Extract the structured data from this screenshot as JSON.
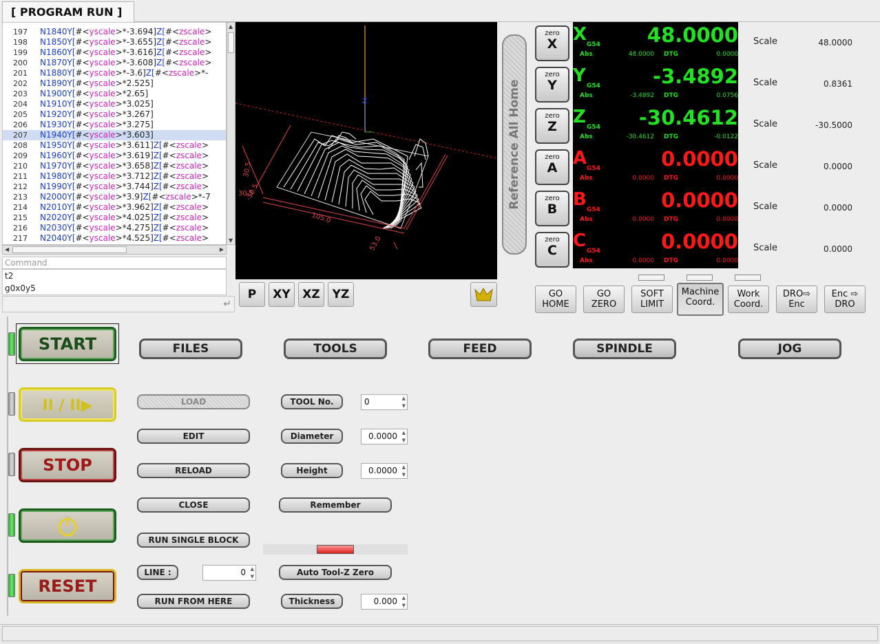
{
  "tab": {
    "title": "[ PROGRAM RUN ]"
  },
  "gcode_lines": [
    {
      "num": "197",
      "n": "N1840",
      "rest": [
        [
          "c-k",
          "Y["
        ],
        [
          "c-v",
          "#<"
        ],
        [
          "c-p",
          "yscale"
        ],
        [
          "c-v",
          ">*-3.694]"
        ],
        [
          "c-k",
          "Z["
        ],
        [
          "c-v",
          "#<"
        ],
        [
          "c-p",
          "zscale"
        ],
        [
          "c-v",
          ">"
        ]
      ]
    },
    {
      "num": "198",
      "n": "N1850",
      "rest": [
        [
          "c-k",
          "Y["
        ],
        [
          "c-v",
          "#<"
        ],
        [
          "c-p",
          "yscale"
        ],
        [
          "c-v",
          ">*-3.655]"
        ],
        [
          "c-k",
          "Z["
        ],
        [
          "c-v",
          "#<"
        ],
        [
          "c-p",
          "zscale"
        ],
        [
          "c-v",
          ">"
        ]
      ]
    },
    {
      "num": "199",
      "n": "N1860",
      "rest": [
        [
          "c-k",
          "Y["
        ],
        [
          "c-v",
          "#<"
        ],
        [
          "c-p",
          "yscale"
        ],
        [
          "c-v",
          ">*-3.616]"
        ],
        [
          "c-k",
          "Z["
        ],
        [
          "c-v",
          "#<"
        ],
        [
          "c-p",
          "zscale"
        ],
        [
          "c-v",
          ">"
        ]
      ]
    },
    {
      "num": "200",
      "n": "N1870",
      "rest": [
        [
          "c-k",
          "Y["
        ],
        [
          "c-v",
          "#<"
        ],
        [
          "c-p",
          "yscale"
        ],
        [
          "c-v",
          ">*-3.608]"
        ],
        [
          "c-k",
          "Z["
        ],
        [
          "c-v",
          "#<"
        ],
        [
          "c-p",
          "zscale"
        ],
        [
          "c-v",
          ">"
        ]
      ]
    },
    {
      "num": "201",
      "n": "N1880",
      "rest": [
        [
          "c-k",
          "Y["
        ],
        [
          "c-v",
          "#<"
        ],
        [
          "c-p",
          "yscale"
        ],
        [
          "c-v",
          ">*-3.6]"
        ],
        [
          "c-k",
          "Z["
        ],
        [
          "c-v",
          "#<"
        ],
        [
          "c-p",
          "zscale"
        ],
        [
          "c-v",
          ">*-"
        ]
      ]
    },
    {
      "num": "202",
      "n": "N1890",
      "rest": [
        [
          "c-k",
          "Y["
        ],
        [
          "c-v",
          "#<"
        ],
        [
          "c-p",
          "yscale"
        ],
        [
          "c-v",
          ">*2.525]"
        ]
      ]
    },
    {
      "num": "203",
      "n": "N1900",
      "rest": [
        [
          "c-k",
          "Y["
        ],
        [
          "c-v",
          "#<"
        ],
        [
          "c-p",
          "yscale"
        ],
        [
          "c-v",
          ">*2.65]"
        ]
      ]
    },
    {
      "num": "204",
      "n": "N1910",
      "rest": [
        [
          "c-k",
          "Y["
        ],
        [
          "c-v",
          "#<"
        ],
        [
          "c-p",
          "yscale"
        ],
        [
          "c-v",
          ">*3.025]"
        ]
      ]
    },
    {
      "num": "205",
      "n": "N1920",
      "rest": [
        [
          "c-k",
          "Y["
        ],
        [
          "c-v",
          "#<"
        ],
        [
          "c-p",
          "yscale"
        ],
        [
          "c-v",
          ">*3.267]"
        ]
      ]
    },
    {
      "num": "206",
      "n": "N1930",
      "rest": [
        [
          "c-k",
          "Y["
        ],
        [
          "c-v",
          "#<"
        ],
        [
          "c-p",
          "yscale"
        ],
        [
          "c-v",
          ">*3.275]"
        ]
      ]
    },
    {
      "num": "207",
      "n": "N1940",
      "rest": [
        [
          "c-k",
          "Y["
        ],
        [
          "c-v",
          "#<"
        ],
        [
          "c-p",
          "yscale"
        ],
        [
          "c-v",
          ">*3.603]"
        ]
      ],
      "selected": true
    },
    {
      "num": "208",
      "n": "N1950",
      "rest": [
        [
          "c-k",
          "Y["
        ],
        [
          "c-v",
          "#<"
        ],
        [
          "c-p",
          "yscale"
        ],
        [
          "c-v",
          ">*3.611]"
        ],
        [
          "c-k",
          "Z["
        ],
        [
          "c-v",
          "#<"
        ],
        [
          "c-p",
          "zscale"
        ],
        [
          "c-v",
          ">"
        ]
      ]
    },
    {
      "num": "209",
      "n": "N1960",
      "rest": [
        [
          "c-k",
          "Y["
        ],
        [
          "c-v",
          "#<"
        ],
        [
          "c-p",
          "yscale"
        ],
        [
          "c-v",
          ">*3.619]"
        ],
        [
          "c-k",
          "Z["
        ],
        [
          "c-v",
          "#<"
        ],
        [
          "c-p",
          "zscale"
        ],
        [
          "c-v",
          ">"
        ]
      ]
    },
    {
      "num": "210",
      "n": "N1970",
      "rest": [
        [
          "c-k",
          "Y["
        ],
        [
          "c-v",
          "#<"
        ],
        [
          "c-p",
          "yscale"
        ],
        [
          "c-v",
          ">*3.658]"
        ],
        [
          "c-k",
          "Z["
        ],
        [
          "c-v",
          "#<"
        ],
        [
          "c-p",
          "zscale"
        ],
        [
          "c-v",
          ">"
        ]
      ]
    },
    {
      "num": "211",
      "n": "N1980",
      "rest": [
        [
          "c-k",
          "Y["
        ],
        [
          "c-v",
          "#<"
        ],
        [
          "c-p",
          "yscale"
        ],
        [
          "c-v",
          ">*3.712]"
        ],
        [
          "c-k",
          "Z["
        ],
        [
          "c-v",
          "#<"
        ],
        [
          "c-p",
          "zscale"
        ],
        [
          "c-v",
          ">"
        ]
      ]
    },
    {
      "num": "212",
      "n": "N1990",
      "rest": [
        [
          "c-k",
          "Y["
        ],
        [
          "c-v",
          "#<"
        ],
        [
          "c-p",
          "yscale"
        ],
        [
          "c-v",
          ">*3.744]"
        ],
        [
          "c-k",
          "Z["
        ],
        [
          "c-v",
          "#<"
        ],
        [
          "c-p",
          "zscale"
        ],
        [
          "c-v",
          ">"
        ]
      ]
    },
    {
      "num": "213",
      "n": "N2000",
      "rest": [
        [
          "c-k",
          "Y["
        ],
        [
          "c-v",
          "#<"
        ],
        [
          "c-p",
          "yscale"
        ],
        [
          "c-v",
          ">*3.9]"
        ],
        [
          "c-k",
          "Z["
        ],
        [
          "c-v",
          "#<"
        ],
        [
          "c-p",
          "zscale"
        ],
        [
          "c-v",
          ">*-7"
        ]
      ]
    },
    {
      "num": "214",
      "n": "N2010",
      "rest": [
        [
          "c-k",
          "Y["
        ],
        [
          "c-v",
          "#<"
        ],
        [
          "c-p",
          "yscale"
        ],
        [
          "c-v",
          ">*3.962]"
        ],
        [
          "c-k",
          "Z["
        ],
        [
          "c-v",
          "#<"
        ],
        [
          "c-p",
          "zscale"
        ],
        [
          "c-v",
          ">"
        ]
      ]
    },
    {
      "num": "215",
      "n": "N2020",
      "rest": [
        [
          "c-k",
          "Y["
        ],
        [
          "c-v",
          "#<"
        ],
        [
          "c-p",
          "yscale"
        ],
        [
          "c-v",
          ">*4.025]"
        ],
        [
          "c-k",
          "Z["
        ],
        [
          "c-v",
          "#<"
        ],
        [
          "c-p",
          "zscale"
        ],
        [
          "c-v",
          ">"
        ]
      ]
    },
    {
      "num": "216",
      "n": "N2030",
      "rest": [
        [
          "c-k",
          "Y["
        ],
        [
          "c-v",
          "#<"
        ],
        [
          "c-p",
          "yscale"
        ],
        [
          "c-v",
          ">*4.275]"
        ],
        [
          "c-k",
          "Z["
        ],
        [
          "c-v",
          "#<"
        ],
        [
          "c-p",
          "zscale"
        ],
        [
          "c-v",
          ">"
        ]
      ]
    },
    {
      "num": "217",
      "n": "N2040",
      "rest": [
        [
          "c-k",
          "Y["
        ],
        [
          "c-v",
          "#<"
        ],
        [
          "c-p",
          "yscale"
        ],
        [
          "c-v",
          ">*4.525]"
        ],
        [
          "c-k",
          "Z["
        ],
        [
          "c-v",
          "#<"
        ],
        [
          "c-p",
          "zscale"
        ],
        [
          "c-v",
          ">"
        ]
      ]
    }
  ],
  "command": {
    "label": "Command",
    "history": [
      "t2",
      "g0x0y5"
    ]
  },
  "view3d": {
    "dims": [
      "105.0",
      "53.0",
      "-30.5",
      "30.5",
      "30.5"
    ],
    "axis_label": "Z"
  },
  "view_buttons": [
    "P",
    "XY",
    "XZ",
    "YZ"
  ],
  "ref_home_label": "Reference All Home",
  "zero_label": "zero",
  "axes": [
    {
      "axis": "X",
      "coord": "G54",
      "value": "48.0000",
      "abs": "48.0000",
      "dtg": "0.0000",
      "scale": "48.0000",
      "color": "#22e022"
    },
    {
      "axis": "Y",
      "coord": "G54",
      "value": "-3.4892",
      "abs": "-3.4892",
      "dtg": "0.0756",
      "scale": "0.8361",
      "color": "#22e022"
    },
    {
      "axis": "Z",
      "coord": "G54",
      "value": "-30.4612",
      "abs": "-30.4612",
      "dtg": "-0.0122",
      "scale": "-30.5000",
      "color": "#22e022"
    },
    {
      "axis": "A",
      "coord": "G54",
      "value": "0.0000",
      "abs": "0.0000",
      "dtg": "0.0000",
      "scale": "0.0000",
      "color": "#ff1818"
    },
    {
      "axis": "B",
      "coord": "G54",
      "value": "0.0000",
      "abs": "0.0000",
      "dtg": "0.0000",
      "scale": "0.0000",
      "color": "#ff1818"
    },
    {
      "axis": "C",
      "coord": "G54",
      "value": "0.0000",
      "abs": "0.0000",
      "dtg": "0.0000",
      "scale": "0.0000",
      "color": "#ff1818"
    }
  ],
  "labels": {
    "abs": "Abs",
    "dtg": "DTG",
    "scale": "Scale"
  },
  "machine_buttons": [
    {
      "l1": "GO",
      "l2": "HOME"
    },
    {
      "l1": "GO",
      "l2": "ZERO"
    },
    {
      "l1": "SOFT",
      "l2": "LIMIT"
    },
    {
      "l1": "Machine",
      "l2": "Coord."
    },
    {
      "l1": "Work",
      "l2": "Coord."
    },
    {
      "l1": "DRO⇨",
      "l2": "Enc"
    },
    {
      "l1": "Enc ⇨",
      "l2": "DRO"
    }
  ],
  "main_buttons": {
    "start": "START",
    "stop": "STOP",
    "reset": "RESET"
  },
  "tab_buttons": [
    "FILES",
    "TOOLS",
    "FEED",
    "SPINDLE",
    "JOG"
  ],
  "file_buttons": {
    "load": "LOAD",
    "edit": "EDIT",
    "reload": "RELOAD",
    "close": "CLOSE",
    "run_single": "RUN SINGLE BLOCK",
    "line": "LINE :",
    "run_from_here": "RUN FROM HERE"
  },
  "line_value": "0",
  "tool_buttons": {
    "tool_no": "TOOL No.",
    "diameter": "Diameter",
    "height": "Height",
    "remember": "Remember",
    "auto_tool_z": "Auto Tool-Z Zero",
    "thickness": "Thickness"
  },
  "tool_values": {
    "tool_no": "0",
    "diameter": "0.0000",
    "height": "0.0000",
    "thickness": "0.000"
  }
}
